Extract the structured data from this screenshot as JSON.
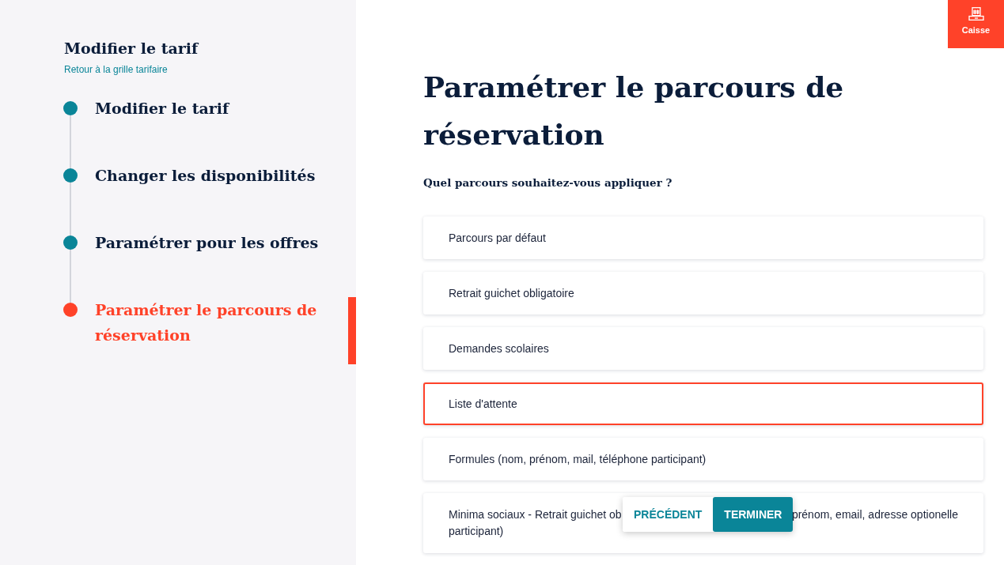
{
  "sidebar": {
    "title": "Modifier le tarif",
    "back_link": "Retour à la grille tarifaire",
    "steps": [
      {
        "label": "Modifier le tarif",
        "selected": false
      },
      {
        "label": "Changer les disponibilités",
        "selected": false
      },
      {
        "label": "Paramétrer pour les offres",
        "selected": false
      },
      {
        "label": "Paramétrer le parcours de réservation",
        "selected": true
      }
    ]
  },
  "main": {
    "title": "Paramétrer le parcours de réservation",
    "question": "Quel parcours souhaitez-vous appliquer ?",
    "options": [
      {
        "label_parts": [
          "Parcours par défaut"
        ],
        "selected": false
      },
      {
        "label_parts": [
          "Retrait guichet obligatoire"
        ],
        "selected": false
      },
      {
        "label_parts": [
          "Demandes scolaires"
        ],
        "selected": false
      },
      {
        "label_parts": [
          "Liste d'attente"
        ],
        "selected": true
      },
      {
        "label_parts": [
          "Formules (nom, prénom, mail, téléphone participant)"
        ],
        "selected": false
      },
      {
        "label_parts": [
          "Minima sociaux - Retrait guichet ob",
          "prénom, email, adresse optionelle",
          "participant)"
        ],
        "selected": false
      }
    ]
  },
  "footer_actions": [
    {
      "label": "PRÉCÉDENT",
      "kind": "secondary"
    },
    {
      "label": "TERMINER",
      "kind": "primary"
    }
  ],
  "cash_register_button": {
    "label": "Caisse"
  }
}
